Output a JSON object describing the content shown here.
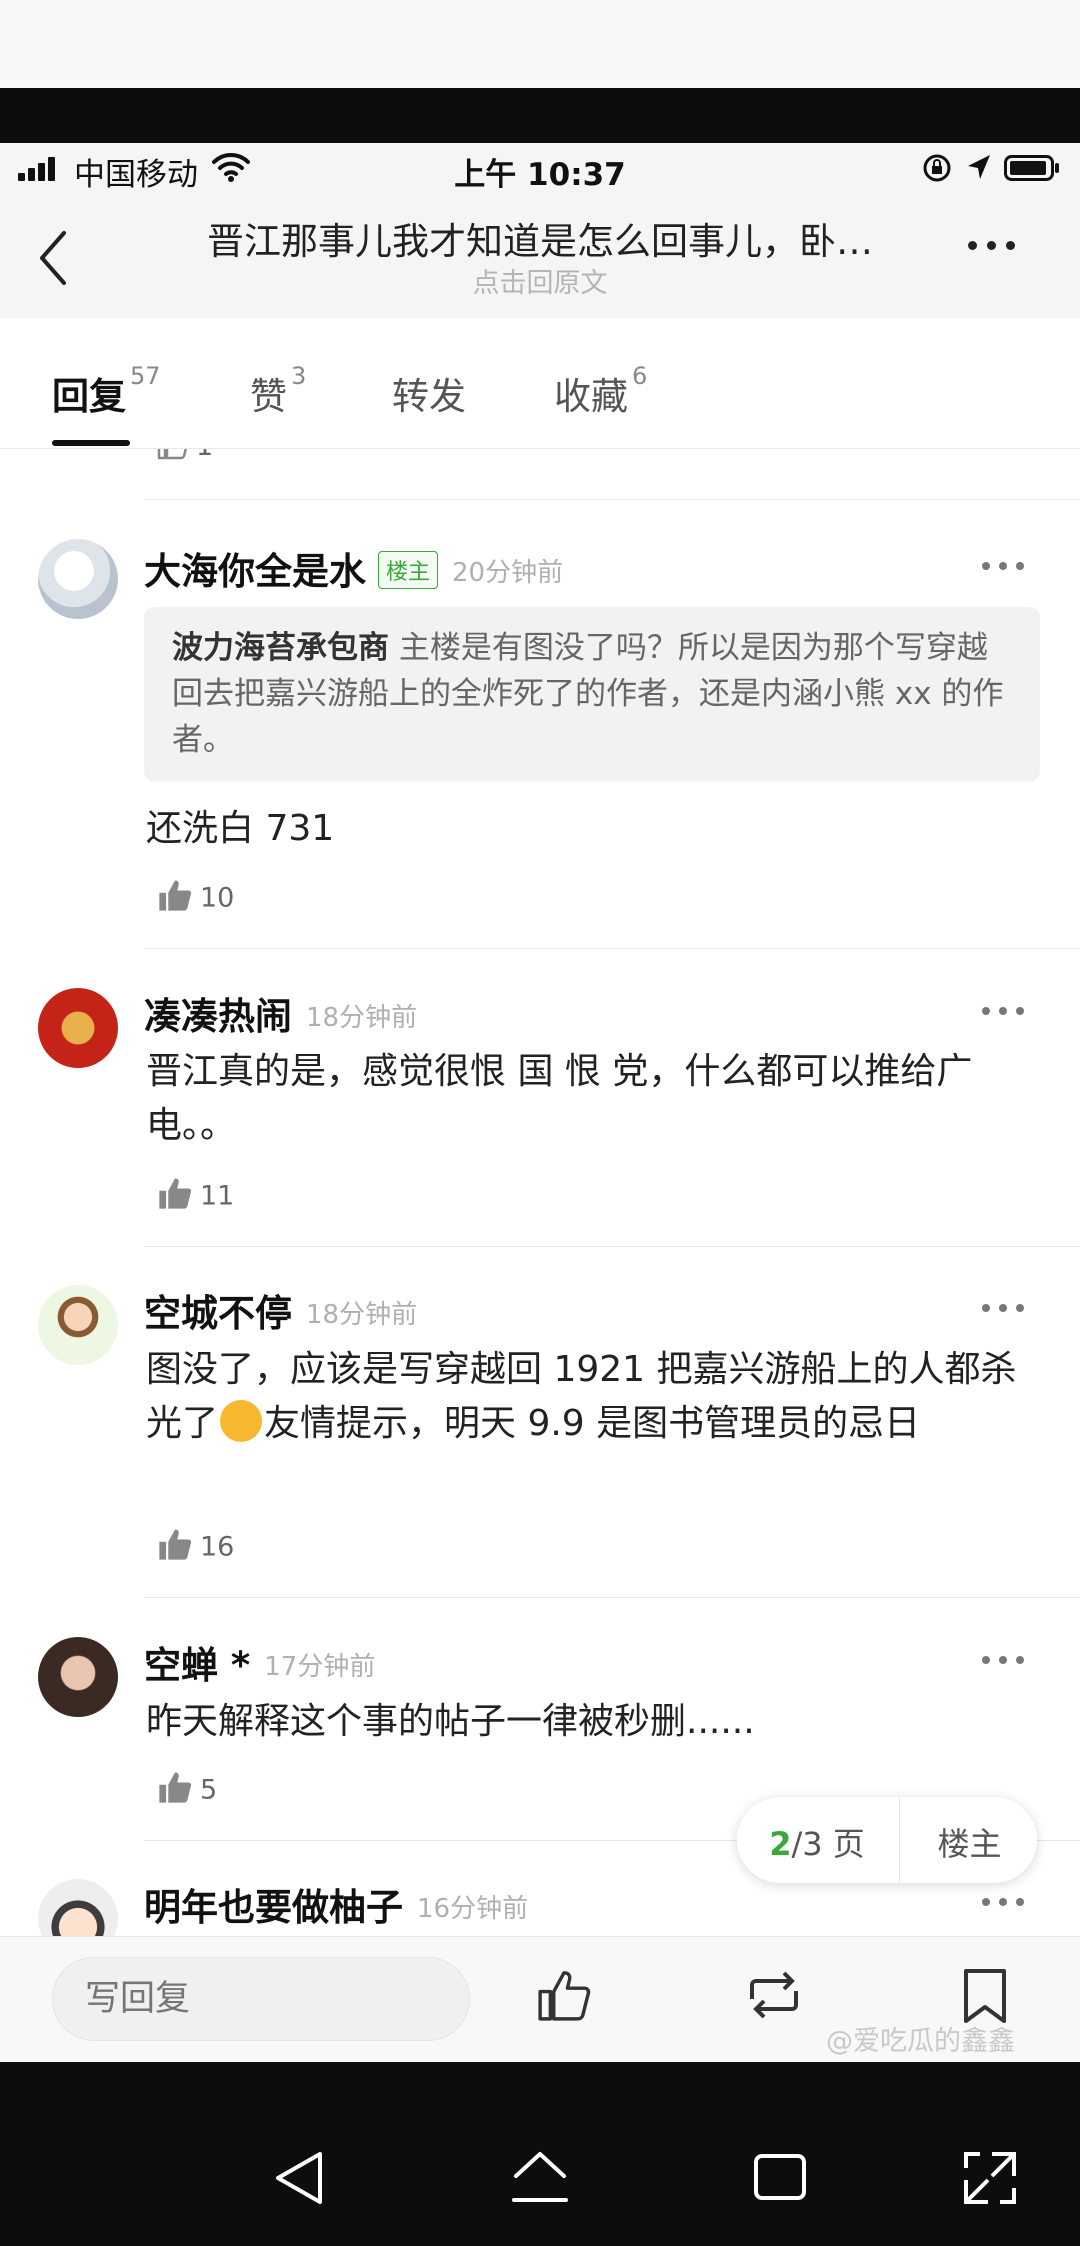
{
  "status_bar": {
    "carrier": "中国移动",
    "time": "上午 10:37"
  },
  "header": {
    "title": "晋江那事儿我才知道是怎么回事儿，卧…",
    "subtitle": "点击回原文"
  },
  "tabs": [
    {
      "label": "回复",
      "count": "57"
    },
    {
      "label": "赞",
      "count": "3"
    },
    {
      "label": "转发",
      "count": ""
    },
    {
      "label": "收藏",
      "count": "6"
    }
  ],
  "partial_top_like": "1",
  "comments": [
    {
      "user": "大海你全是水",
      "badge": "楼主",
      "time": "20分钟前",
      "quote_user": "波力海苔承包商",
      "quote_text": "主楼是有图没了吗？所以是因为那个写穿越回去把嘉兴游船上的全炸死了的作者，还是内涵小熊 xx 的作者。",
      "text": "还洗白 731",
      "likes": "10"
    },
    {
      "user": "凑凑热闹",
      "time": "18分钟前",
      "text": "晋江真的是，感觉很恨 国 恨  党，什么都可以推给广电。。",
      "likes": "11"
    },
    {
      "user": "空城不停",
      "time": "18分钟前",
      "text_before_emoji": "图没了，应该是写穿越回 1921 把嘉兴游船上的人都杀光了",
      "text_after_emoji": "友情提示，明天 9.9 是图书管理员的忌日",
      "likes": "16"
    },
    {
      "user": "空蝉",
      "user_star": "*",
      "time": "17分钟前",
      "text": "昨天解释这个事的帖子一律被秒删......",
      "likes": "5"
    },
    {
      "user": "明年也要做柚子",
      "time": "16分钟前"
    }
  ],
  "pager": {
    "current": "2",
    "total_text": "/3 页",
    "op_button": "楼主"
  },
  "bottom_bar": {
    "reply_placeholder": "写回复",
    "watermark": "@爱吃瓜的鑫鑫"
  },
  "colors": {
    "accent_green": "#3aa83a",
    "background": "#ffffff",
    "nav_background": "#0d0d0d"
  },
  "icons": [
    "signal-icon",
    "wifi-icon",
    "lock-icon",
    "location-icon",
    "battery-icon",
    "back-icon",
    "more-icon",
    "thumbs-up-icon",
    "share-icon",
    "bookmark-icon",
    "nav-back-icon",
    "nav-home-icon",
    "nav-recent-icon",
    "nav-expand-icon"
  ]
}
